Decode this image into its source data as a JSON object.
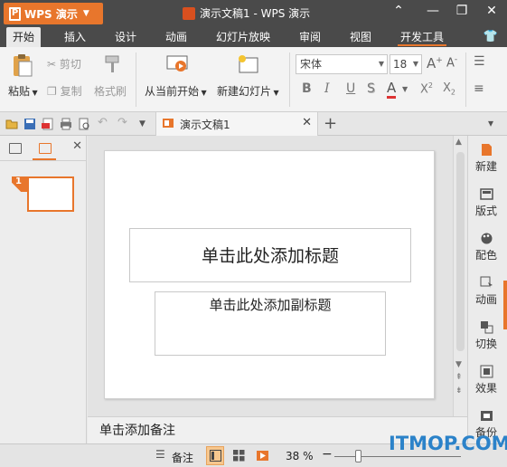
{
  "app": {
    "menu_label": "WPS 演示",
    "logo_letter": "P",
    "document_title": "演示文稿1 - WPS 演示",
    "accent_color": "#e8762c"
  },
  "ribbon_tabs": [
    "开始",
    "插入",
    "设计",
    "动画",
    "幻灯片放映",
    "审阅",
    "视图",
    "开发工具"
  ],
  "ribbon": {
    "paste": "粘贴",
    "cut": "剪切",
    "copy": "复制",
    "format_painter": "格式刷",
    "from_current": "从当前开始",
    "new_slide": "新建幻灯片",
    "font_name": "宋体",
    "font_size": "18"
  },
  "quick_access": {
    "doc_tab_title": "演示文稿1"
  },
  "slide_panel": {
    "slide_number": "1"
  },
  "slide": {
    "title_placeholder": "单击此处添加标题",
    "subtitle_placeholder": "单击此处添加副标题"
  },
  "notes": {
    "placeholder": "单击添加备注"
  },
  "task_pane": [
    "新建",
    "版式",
    "配色",
    "动画",
    "切换",
    "效果",
    "备份"
  ],
  "status": {
    "notes_label": "备注",
    "zoom": "38 %"
  },
  "watermark": "ITMOP.COM"
}
